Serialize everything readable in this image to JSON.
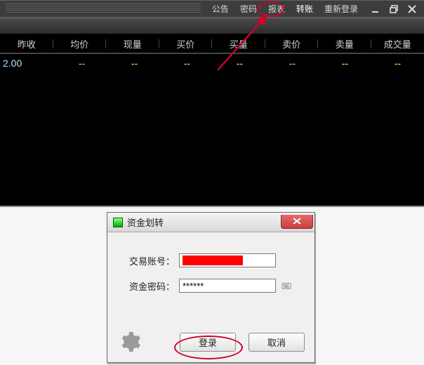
{
  "menu": {
    "items": [
      {
        "key": "notice",
        "label": "公告"
      },
      {
        "key": "password",
        "label": "密码"
      },
      {
        "key": "report",
        "label": "报表"
      },
      {
        "key": "transfer",
        "label": "转账",
        "highlight": true
      },
      {
        "key": "relogin",
        "label": "重新登录"
      }
    ]
  },
  "table": {
    "headers": [
      "昨收",
      "均价",
      "现量",
      "买价",
      "买量",
      "卖价",
      "卖量",
      "成交量"
    ],
    "row": {
      "close": "2.00",
      "avg": "--",
      "vol_now": "--",
      "bid": "--",
      "bid_vol": "--",
      "ask": "--",
      "ask_vol": "--",
      "turnover": "--"
    }
  },
  "dialog": {
    "title": "资金划转",
    "fields": {
      "account_label": "交易账号：",
      "account_value_redacted": true,
      "password_label": "资金密码：",
      "password_value": "******"
    },
    "buttons": {
      "login": "登录",
      "cancel": "取消"
    }
  }
}
